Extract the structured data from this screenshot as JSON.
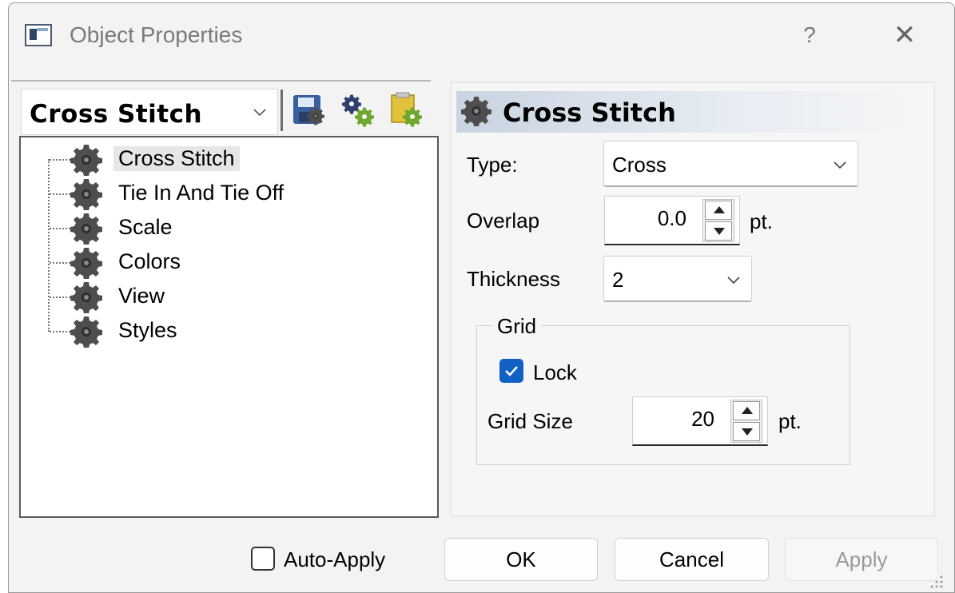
{
  "window": {
    "title": "Object Properties",
    "help_label": "?",
    "close_label": "✕"
  },
  "left_panel": {
    "object_combo_value": "Cross Stitch",
    "toolbar_icons": [
      "save-settings-icon",
      "gears-icon",
      "load-settings-icon"
    ],
    "tree_items": [
      {
        "label": "Cross Stitch",
        "selected": true
      },
      {
        "label": "Tie In And Tie Off",
        "selected": false
      },
      {
        "label": "Scale",
        "selected": false
      },
      {
        "label": "Colors",
        "selected": false
      },
      {
        "label": "View",
        "selected": false
      },
      {
        "label": "Styles",
        "selected": false
      }
    ]
  },
  "right_panel": {
    "header_title": "Cross Stitch",
    "type_label": "Type:",
    "type_value": "Cross",
    "overlap_label": "Overlap",
    "overlap_value": "0.0",
    "overlap_unit": "pt.",
    "thickness_label": "Thickness",
    "thickness_value": "2",
    "grid_group_title": "Grid",
    "lock_label": "Lock",
    "lock_checked": true,
    "grid_size_label": "Grid Size",
    "grid_size_value": "20",
    "grid_size_unit": "pt."
  },
  "footer": {
    "auto_apply_label": "Auto-Apply",
    "auto_apply_checked": false,
    "ok_label": "OK",
    "cancel_label": "Cancel",
    "apply_label": "Apply"
  },
  "colors": {
    "accent": "#1160c4",
    "header_gradient": "#c9d4e2",
    "gear": "#555555"
  }
}
